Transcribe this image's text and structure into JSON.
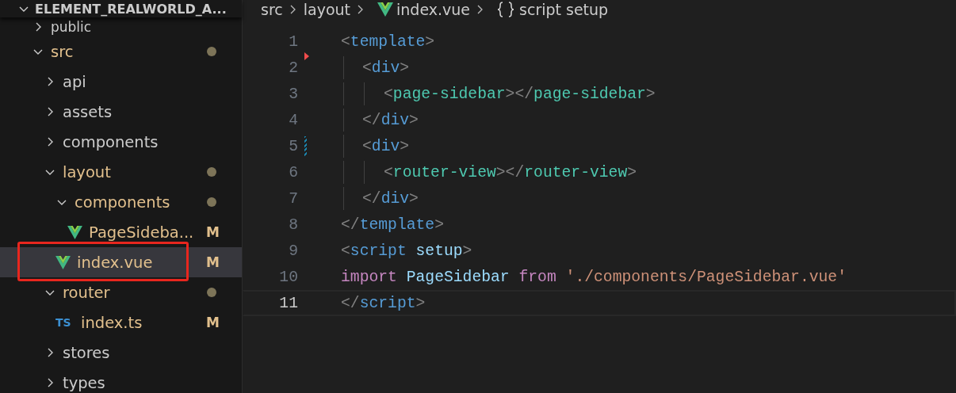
{
  "explorer": {
    "title": "ELEMENT_REALWORLD_A...",
    "items": [
      {
        "name": "public",
        "kind": "folder",
        "expanded": false
      },
      {
        "name": "src",
        "kind": "folder",
        "expanded": true,
        "modified_dot": true,
        "children": [
          {
            "name": "api",
            "kind": "folder",
            "expanded": false
          },
          {
            "name": "assets",
            "kind": "folder",
            "expanded": false
          },
          {
            "name": "components",
            "kind": "folder",
            "expanded": false
          },
          {
            "name": "layout",
            "kind": "folder",
            "expanded": true,
            "modified_dot": true,
            "children": [
              {
                "name": "components",
                "kind": "folder",
                "expanded": true,
                "modified_dot": true,
                "children": [
                  {
                    "name": "PageSideba...",
                    "kind": "vue",
                    "badge": "M",
                    "selected": false
                  }
                ]
              },
              {
                "name": "index.vue",
                "kind": "vue",
                "badge": "M",
                "selected": true,
                "annotated": true
              }
            ]
          },
          {
            "name": "router",
            "kind": "folder",
            "expanded": true,
            "modified_dot": true,
            "children": [
              {
                "name": "index.ts",
                "kind": "ts",
                "icon_text": "TS",
                "badge": "M",
                "selected": false
              }
            ]
          },
          {
            "name": "stores",
            "kind": "folder",
            "expanded": false
          },
          {
            "name": "types",
            "kind": "folder",
            "expanded": false
          }
        ]
      }
    ]
  },
  "breadcrumb": [
    {
      "text": "src",
      "kind": "plain"
    },
    {
      "text": "layout",
      "kind": "plain"
    },
    {
      "text": "index.vue",
      "kind": "vue"
    },
    {
      "text": "script setup",
      "kind": "braces"
    }
  ],
  "editor": {
    "lines": [
      {
        "number": "1",
        "current": false,
        "tokens": [
          {
            "kind": "punct",
            "text": "<"
          },
          {
            "kind": "tag",
            "text": "template"
          },
          {
            "kind": "punct",
            "text": ">"
          }
        ],
        "children": [
          {
            "number": "2",
            "current": false,
            "marker": {
              "kind": "deleted"
            },
            "tokens": [
              {
                "kind": "punct",
                "text": "<"
              },
              {
                "kind": "tag",
                "text": "div"
              },
              {
                "kind": "punct",
                "text": ">"
              }
            ],
            "children": [
              {
                "number": "3",
                "current": false,
                "tokens": [
                  {
                    "kind": "punct",
                    "text": "<"
                  },
                  {
                    "kind": "component",
                    "text": "page-sidebar"
                  },
                  {
                    "kind": "punct",
                    "text": "></"
                  },
                  {
                    "kind": "component",
                    "text": "page-sidebar"
                  },
                  {
                    "kind": "punct",
                    "text": ">"
                  }
                ]
              }
            ]
          },
          {
            "number": "4",
            "current": false,
            "tokens": [
              {
                "kind": "punct",
                "text": "</"
              },
              {
                "kind": "tag",
                "text": "div"
              },
              {
                "kind": "punct",
                "text": ">"
              }
            ]
          },
          {
            "number": "5",
            "current": false,
            "marker": {
              "kind": "modified"
            },
            "tokens": [
              {
                "kind": "punct",
                "text": "<"
              },
              {
                "kind": "tag",
                "text": "div"
              },
              {
                "kind": "punct",
                "text": ">"
              }
            ],
            "children": [
              {
                "number": "6",
                "current": false,
                "tokens": [
                  {
                    "kind": "punct",
                    "text": "<"
                  },
                  {
                    "kind": "component",
                    "text": "router-view"
                  },
                  {
                    "kind": "punct",
                    "text": "></"
                  },
                  {
                    "kind": "component",
                    "text": "router-view"
                  },
                  {
                    "kind": "punct",
                    "text": ">"
                  }
                ]
              }
            ]
          },
          {
            "number": "7",
            "current": false,
            "tokens": [
              {
                "kind": "punct",
                "text": "</"
              },
              {
                "kind": "tag",
                "text": "div"
              },
              {
                "kind": "punct",
                "text": ">"
              }
            ]
          }
        ]
      },
      {
        "number": "8",
        "current": false,
        "tokens": [
          {
            "kind": "punct",
            "text": "</"
          },
          {
            "kind": "tag",
            "text": "template"
          },
          {
            "kind": "punct",
            "text": ">"
          }
        ]
      },
      {
        "number": "9",
        "current": false,
        "tokens": [
          {
            "kind": "punct",
            "text": "<"
          },
          {
            "kind": "tag",
            "text": "script"
          },
          {
            "kind": "attr",
            "text": " setup"
          },
          {
            "kind": "punct",
            "text": ">"
          }
        ]
      },
      {
        "number": "10",
        "current": false,
        "tokens": [
          {
            "kind": "keyword",
            "text": "import"
          },
          {
            "kind": "ident",
            "text": " PageSidebar"
          },
          {
            "kind": "keyword",
            "text": " from"
          },
          {
            "kind": "string",
            "text": " './components/PageSidebar.vue'"
          }
        ]
      },
      {
        "number": "11",
        "current": true,
        "tokens": [
          {
            "kind": "punct",
            "text": "</"
          },
          {
            "kind": "tag",
            "text": "script"
          },
          {
            "kind": "punct",
            "text": ">"
          }
        ]
      }
    ]
  }
}
